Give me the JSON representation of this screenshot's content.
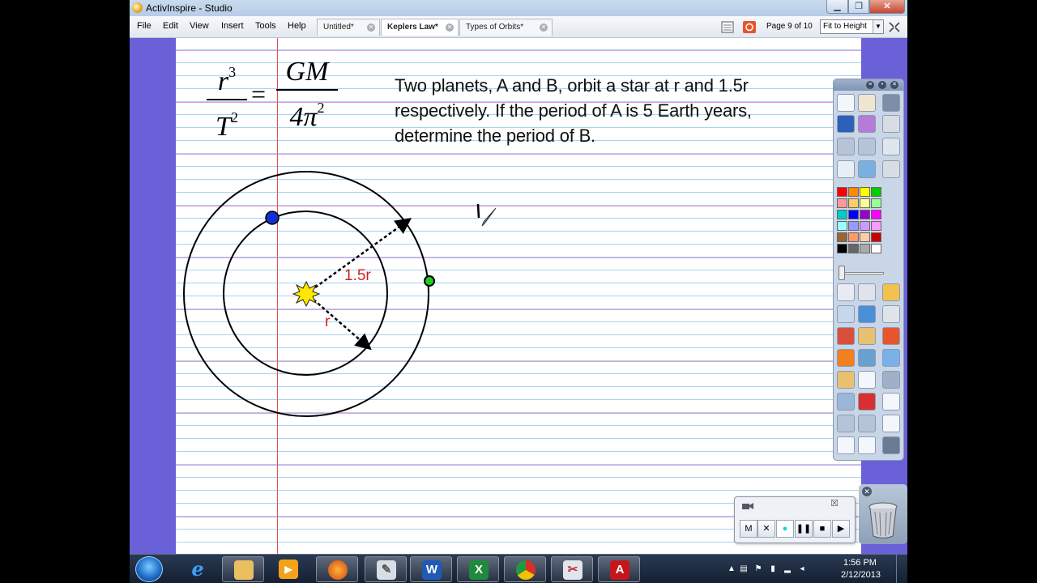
{
  "window": {
    "title": "ActivInspire - Studio"
  },
  "menu": [
    "File",
    "Edit",
    "View",
    "Insert",
    "Tools",
    "Help"
  ],
  "tabs": [
    {
      "label": "Untitled*",
      "active": false
    },
    {
      "label": "Keplers Law*",
      "active": true
    },
    {
      "label": "Types of Orbits*",
      "active": false
    }
  ],
  "page_indicator": "Page 9 of 10",
  "zoom": {
    "value": "Fit to Height"
  },
  "flipchart": {
    "formula": {
      "lhs_num": "r",
      "lhs_num_exp": "3",
      "lhs_den": "T",
      "lhs_den_exp": "2",
      "equals": "=",
      "rhs_num": "GM",
      "rhs_den": "4π",
      "rhs_den_exp": "2"
    },
    "problem_lines": [
      "Two planets, A and B, orbit a star at r and 1.5r",
      "respectively. If the period of A is 5 Earth years,",
      "determine the period of B."
    ],
    "diagram": {
      "outer_label": "1.5r",
      "inner_label": "r",
      "colors": {
        "inner_planet": "#1030d0",
        "outer_planet": "#22cc22",
        "star": "#ffe800",
        "label": "#d02020"
      }
    }
  },
  "palette": [
    "#ff0000",
    "#ff8800",
    "#ffff00",
    "#00cc00",
    "#ff9999",
    "#ffcc66",
    "#ffff99",
    "#99ff99",
    "#00cccc",
    "#0000ff",
    "#9900cc",
    "#ff00ff",
    "#99ffff",
    "#9999ff",
    "#cc99ff",
    "#ff99ff",
    "#996633",
    "#ff9966",
    "#ffccaa",
    "#cc0000",
    "#000000",
    "#666666",
    "#aaaaaa",
    "#ffffff"
  ],
  "recorder": {
    "buttons": [
      "M",
      "✕",
      "●",
      "❚❚",
      "■",
      "▶"
    ]
  },
  "clock": {
    "time": "1:56 PM",
    "date": "2/12/2013"
  }
}
